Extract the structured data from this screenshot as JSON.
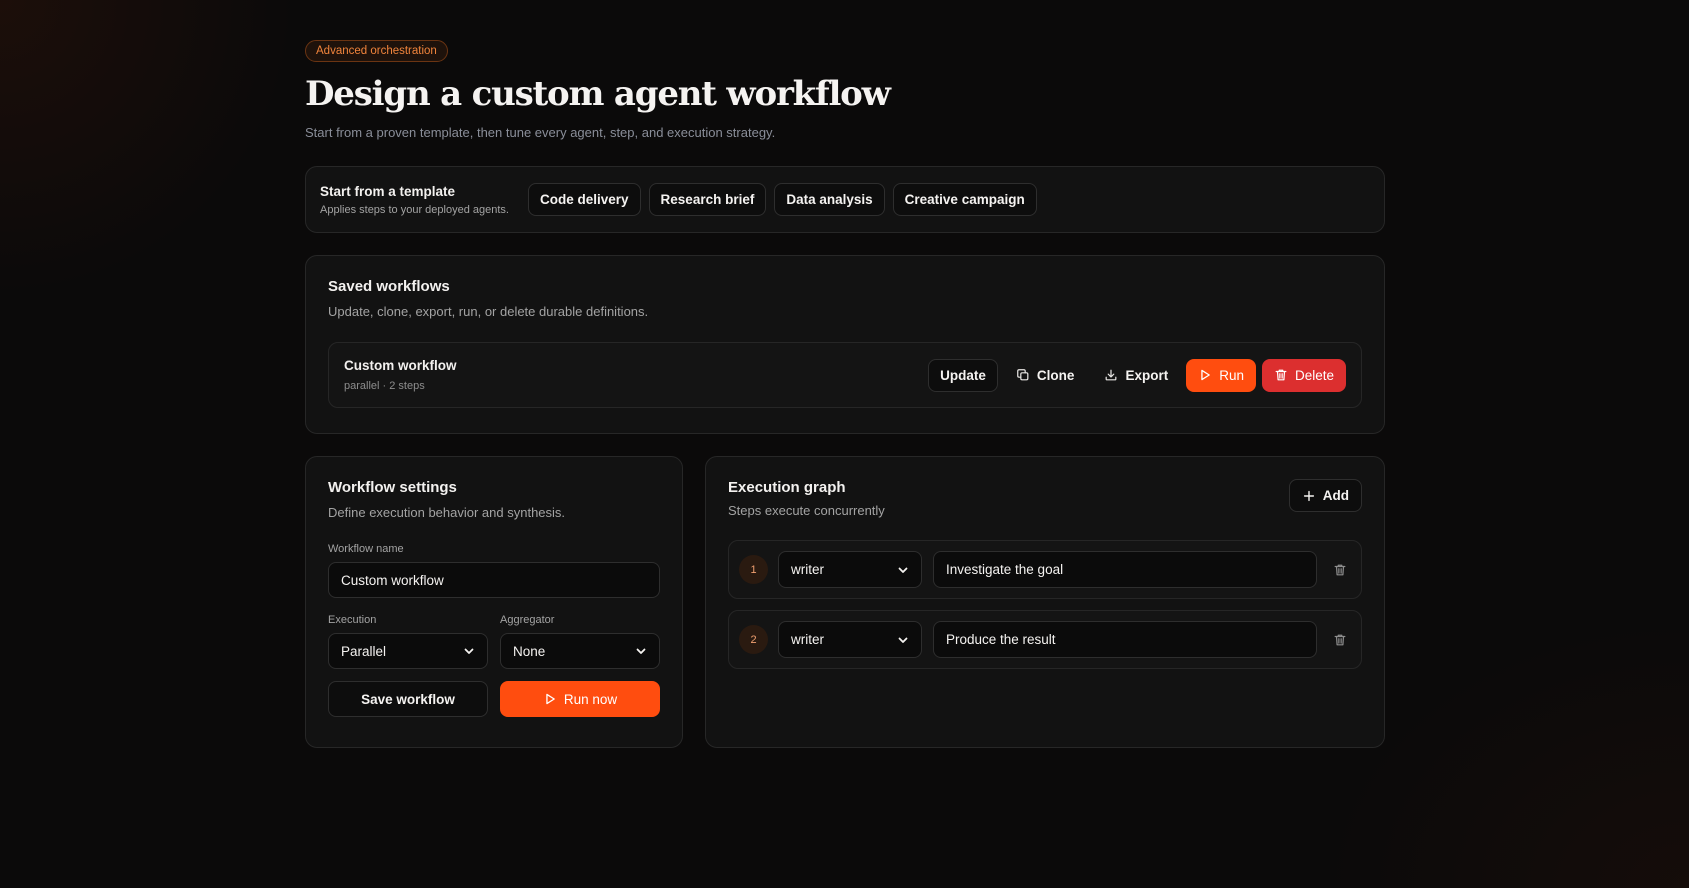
{
  "hero": {
    "badge": "Advanced orchestration",
    "title": "Design a custom agent workflow",
    "subtitle": "Start from a proven template, then tune every agent, step, and execution strategy."
  },
  "templates": {
    "title": "Start from a template",
    "description": "Applies steps to your deployed agents.",
    "items": [
      "Code delivery",
      "Research brief",
      "Data analysis",
      "Creative campaign"
    ]
  },
  "saved": {
    "title": "Saved workflows",
    "description": "Update, clone, export, run, or delete durable definitions.",
    "workflow": {
      "name": "Custom workflow",
      "meta": "parallel · 2 steps",
      "actions": {
        "update": "Update",
        "clone": "Clone",
        "export": "Export",
        "run": "Run",
        "delete": "Delete"
      }
    }
  },
  "settings": {
    "title": "Workflow settings",
    "description": "Define execution behavior and synthesis.",
    "name_label": "Workflow name",
    "name_value": "Custom workflow",
    "execution_label": "Execution",
    "execution_value": "Parallel",
    "aggregator_label": "Aggregator",
    "aggregator_value": "None",
    "save_label": "Save workflow",
    "run_label": "Run now"
  },
  "graph": {
    "title": "Execution graph",
    "description": "Steps execute concurrently",
    "add_label": "Add",
    "steps": [
      {
        "number": "1",
        "agent": "writer",
        "instruction": "Investigate the goal"
      },
      {
        "number": "2",
        "agent": "writer",
        "instruction": "Produce the result"
      }
    ]
  },
  "colors": {
    "accent": "#ff4d0f",
    "danger": "#dc2f2f",
    "badge_text": "#f0843c"
  }
}
